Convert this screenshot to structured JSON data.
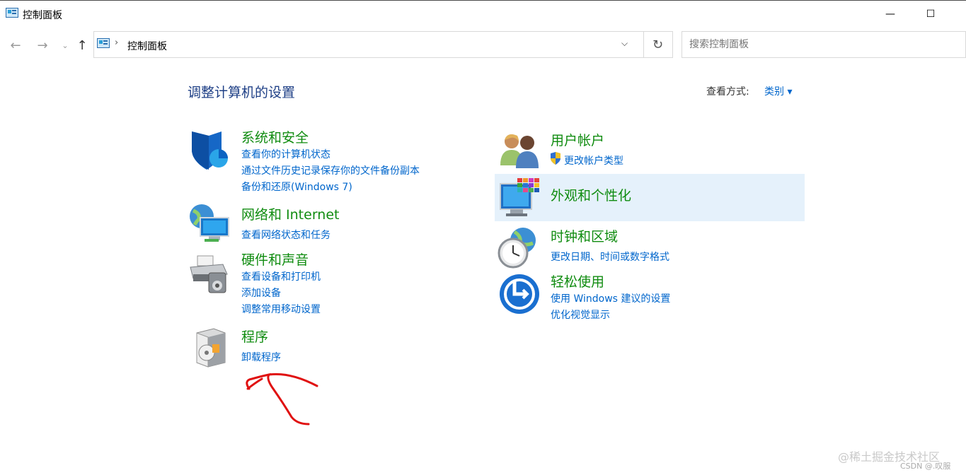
{
  "window": {
    "title": "控制面板"
  },
  "addressbar": {
    "crumb": "控制面板"
  },
  "search": {
    "placeholder": "搜索控制面板"
  },
  "main": {
    "heading": "调整计算机的设置",
    "view_by_label": "查看方式:",
    "view_by_value": "类别 ▾"
  },
  "left_categories": [
    {
      "title": "系统和安全",
      "links": [
        "查看你的计算机状态",
        "通过文件历史记录保存你的文件备份副本",
        "备份和还原(Windows 7)"
      ]
    },
    {
      "title": "网络和 Internet",
      "links": [
        "查看网络状态和任务"
      ]
    },
    {
      "title": "硬件和声音",
      "links": [
        "查看设备和打印机",
        "添加设备",
        "调整常用移动设置"
      ]
    },
    {
      "title": "程序",
      "links": [
        "卸载程序"
      ]
    }
  ],
  "right_categories": [
    {
      "title": "用户帐户",
      "links": [
        "更改帐户类型"
      ]
    },
    {
      "title": "外观和个性化",
      "links": []
    },
    {
      "title": "时钟和区域",
      "links": [
        "更改日期、时间或数字格式"
      ]
    },
    {
      "title": "轻松使用",
      "links": [
        "使用 Windows 建议的设置",
        "优化视觉显示"
      ]
    }
  ],
  "watermark": {
    "line1": "@稀土掘金技术社区",
    "line2": "CSDN @.叹服"
  },
  "colors": {
    "title_green": "#108c10",
    "link_blue": "#0066cc",
    "heading_blue": "#1e3f86",
    "hover_bg": "#e5f1fb",
    "annotation_red": "#e01010"
  }
}
